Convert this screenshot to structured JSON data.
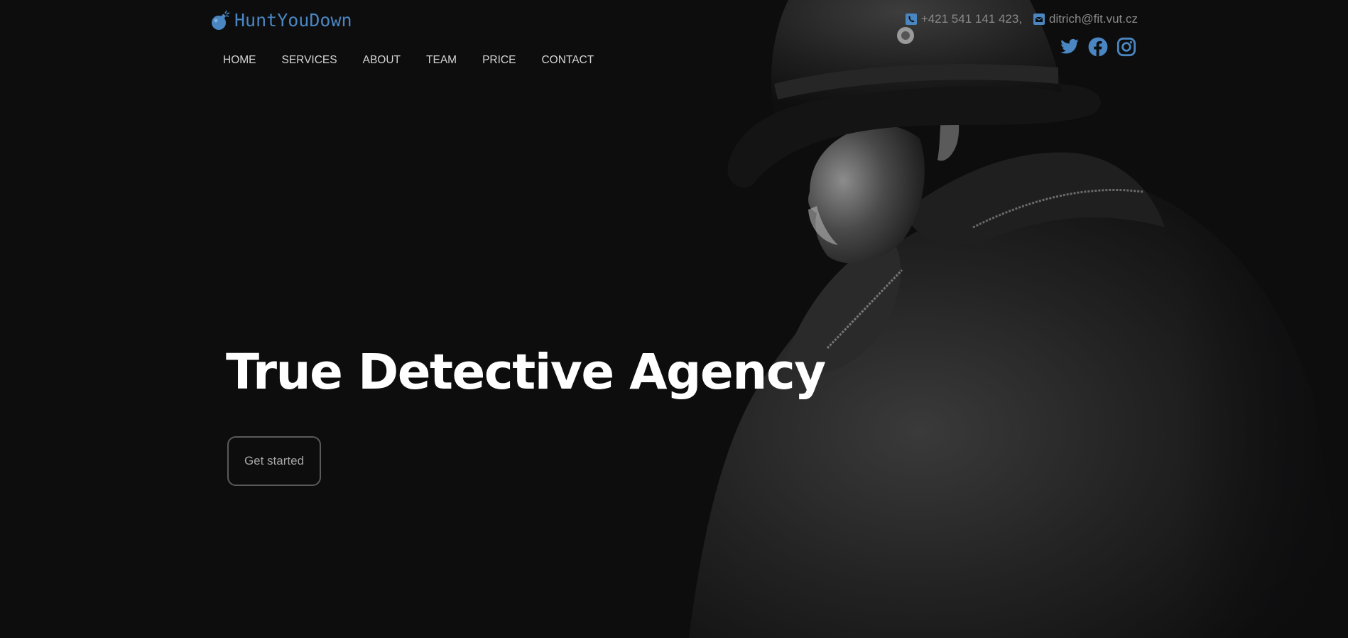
{
  "brand": {
    "name": "HuntYouDown",
    "logo_icon": "bomb-icon",
    "accent_color": "#4a86c1"
  },
  "nav": {
    "items": [
      {
        "label": "HOME"
      },
      {
        "label": "SERVICES"
      },
      {
        "label": "ABOUT"
      },
      {
        "label": "TEAM"
      },
      {
        "label": "PRICE"
      },
      {
        "label": "CONTACT"
      }
    ]
  },
  "contact": {
    "phone": "+421 541 141 423,",
    "phone_icon": "phone-icon",
    "email": "ditrich@fit.vut.cz",
    "email_icon": "envelope-icon"
  },
  "social": {
    "icons": [
      "twitter-icon",
      "facebook-icon",
      "instagram-icon"
    ]
  },
  "hero": {
    "title": "True Detective Agency",
    "cta_label": "Get started",
    "image_description_icon": "detective-photo"
  },
  "colors": {
    "background": "#0d0d0e",
    "text": "#ffffff",
    "nav_text": "#d4d4d4",
    "muted_text": "#8a8a8a"
  }
}
